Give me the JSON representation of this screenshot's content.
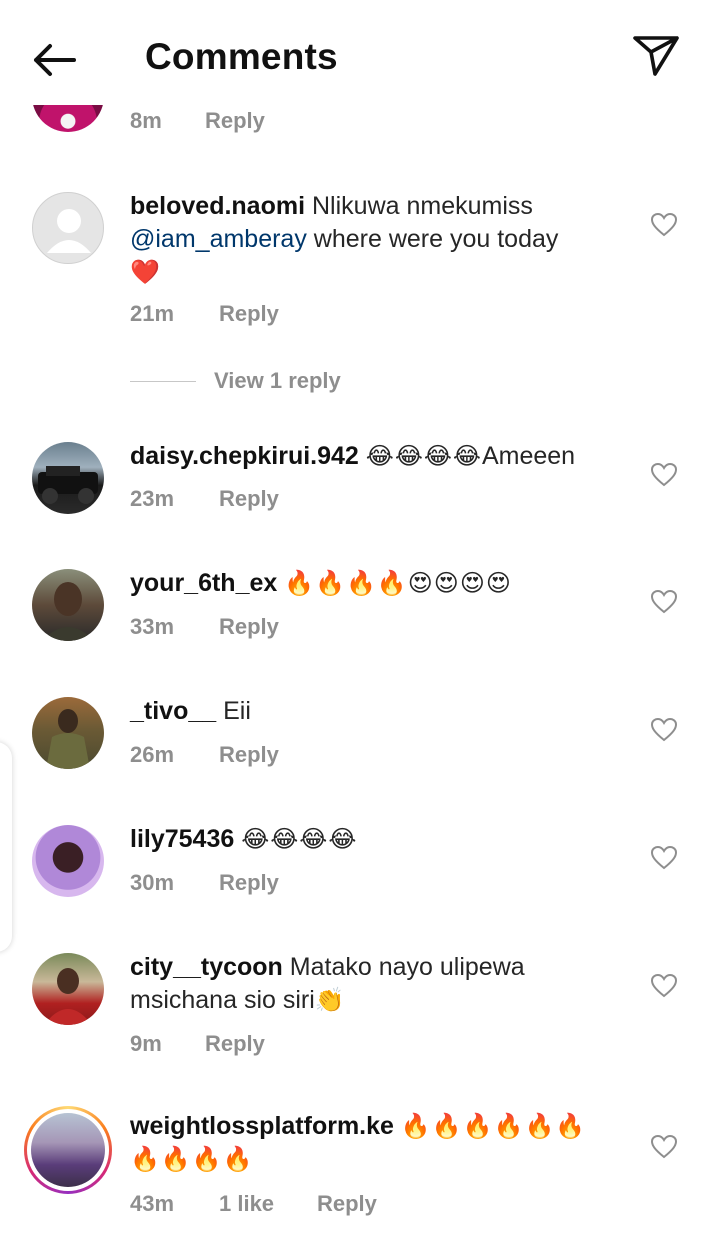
{
  "header": {
    "title": "Comments",
    "back_icon": "arrow-left-icon",
    "send_icon": "paper-plane-icon"
  },
  "partial_comment": {
    "time": "8m",
    "reply_label": "Reply"
  },
  "comments": [
    {
      "username": "beloved.naomi",
      "text_before": "Nlikuwa nmekumiss",
      "mention": "@iam_amberay",
      "text_after": "where were you today",
      "emoji": "❤️",
      "time": "21m",
      "reply_label": "Reply",
      "view_replies": "View 1 reply"
    },
    {
      "username": "daisy.chepkirui.942",
      "emoji": "😂😂😂😂",
      "text": "Ameeen",
      "time": "23m",
      "reply_label": "Reply"
    },
    {
      "username": "your_6th_ex",
      "emoji": "🔥🔥🔥🔥😍😍😍😍",
      "time": "33m",
      "reply_label": "Reply"
    },
    {
      "username": "_tivo__",
      "text": "Eii",
      "time": "26m",
      "reply_label": "Reply"
    },
    {
      "username": "lily75436",
      "emoji": "😂😂😂😂",
      "time": "30m",
      "reply_label": "Reply"
    },
    {
      "username": "city__tycoon",
      "text": "Matako nayo ulipewa msichana sio siri",
      "emoji": "👏",
      "time": "9m",
      "reply_label": "Reply"
    },
    {
      "username": "weightlossplatform.ke",
      "emoji_line1": "🔥🔥🔥🔥🔥🔥",
      "emoji_line2": "🔥🔥🔥🔥",
      "time": "43m",
      "likes": "1 like",
      "reply_label": "Reply"
    }
  ],
  "colors": {
    "text": "#262626",
    "meta": "#8e8e8e",
    "mention": "#00376b",
    "story_ring": "#d6249f"
  }
}
